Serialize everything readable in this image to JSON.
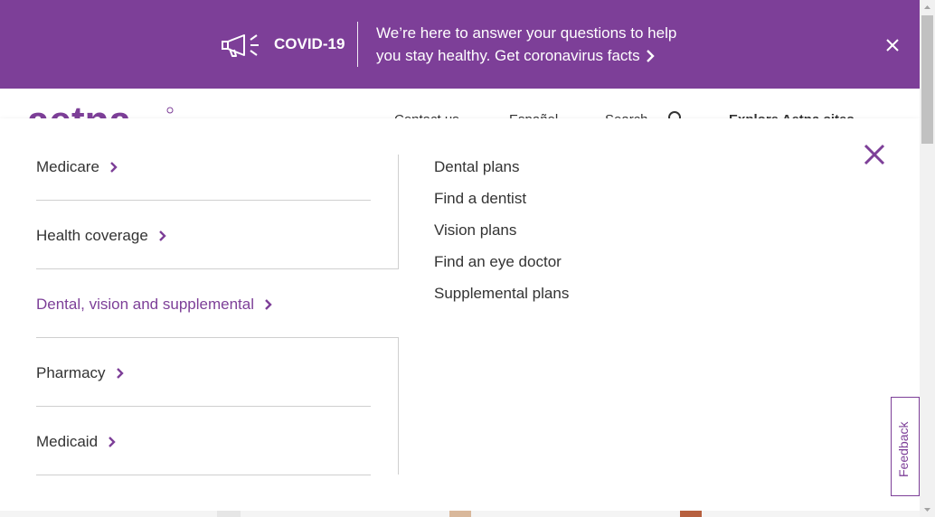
{
  "banner": {
    "title": "COVID-19",
    "message": "We’re here to answer your questions to help you stay healthy. Get coronavirus facts",
    "color": "#7d3f98"
  },
  "header": {
    "logo_text": "aetna",
    "nav_peek": [
      "Contact us",
      "Español",
      "Search",
      "Explore Aetna sites"
    ]
  },
  "menu": {
    "categories": [
      {
        "label": "Medicare",
        "active": false
      },
      {
        "label": "Health coverage",
        "active": false
      },
      {
        "label": "Dental, vision and supplemental",
        "active": true
      },
      {
        "label": "Pharmacy",
        "active": false
      },
      {
        "label": "Medicaid",
        "active": false
      }
    ],
    "sub_links": [
      "Dental plans",
      "Find a dentist",
      "Vision plans",
      "Find an eye doctor",
      "Supplemental plans"
    ],
    "accent_color": "#7d3f98"
  },
  "feedback": {
    "label": "Feedback"
  }
}
